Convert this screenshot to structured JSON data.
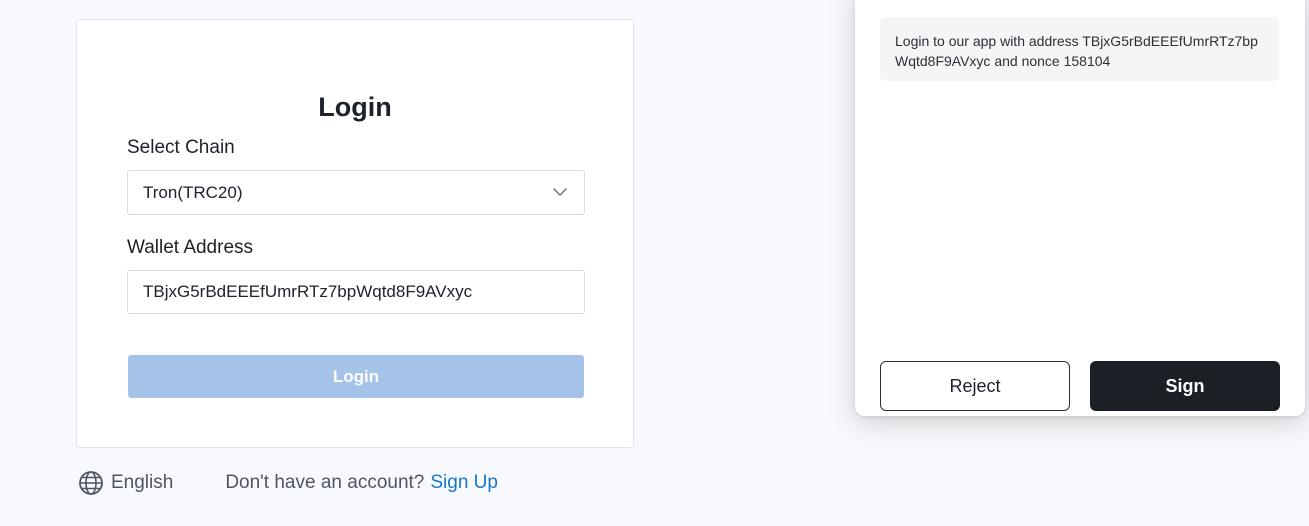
{
  "login_form": {
    "title": "Login",
    "chain": {
      "label": "Select Chain",
      "selected": "Tron(TRC20)"
    },
    "wallet": {
      "label": "Wallet Address",
      "value": "TBjxG5rBdEEEfUmrRTz7bpWqtd8F9AVxyc"
    },
    "submit_label": "Login"
  },
  "footer": {
    "language": "English",
    "signup_prompt": "Don't have an account?",
    "signup_link": "Sign Up"
  },
  "sign_dialog": {
    "message": "Login to our app with address TBjxG5rBdEEEfUmrRTz7bpWqtd8F9AVxyc and nonce 158104",
    "reject_label": "Reject",
    "sign_label": "Sign"
  },
  "colors": {
    "login_button_disabled": "#a5c2e8",
    "link": "#1677c9",
    "sign_button": "#1b2027"
  }
}
